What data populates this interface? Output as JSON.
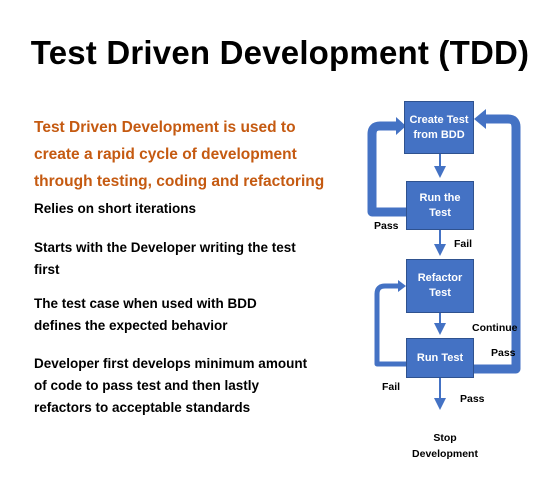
{
  "title": "Test Driven Development (TDD)",
  "intro": "Test Driven Development is used to create a rapid cycle of development through testing, coding and refactoring",
  "bullets": [
    "Relies on short iterations",
    "Starts with the Developer writing the test first",
    "The test case when used with BDD defines the expected behavior",
    "Developer first develops minimum amount of code to pass test and then lastly refactors to acceptable standards"
  ],
  "flowchart": {
    "boxes": {
      "create": "Create Test from BDD",
      "run": "Run the Test",
      "refactor": "Refactor Test",
      "run_test": "Run Test"
    },
    "labels": {
      "pass_1": "Pass",
      "fail_1": "Fail",
      "continue": "Continue",
      "pass_2": "Pass",
      "fail_2": "Fail",
      "pass_3": "Pass",
      "stop": "Stop Development"
    }
  },
  "colors": {
    "title": "#000000",
    "intro_text": "#c55a11",
    "box_fill": "#4472c4",
    "box_text": "#ffffff",
    "connector": "#4472c4"
  }
}
